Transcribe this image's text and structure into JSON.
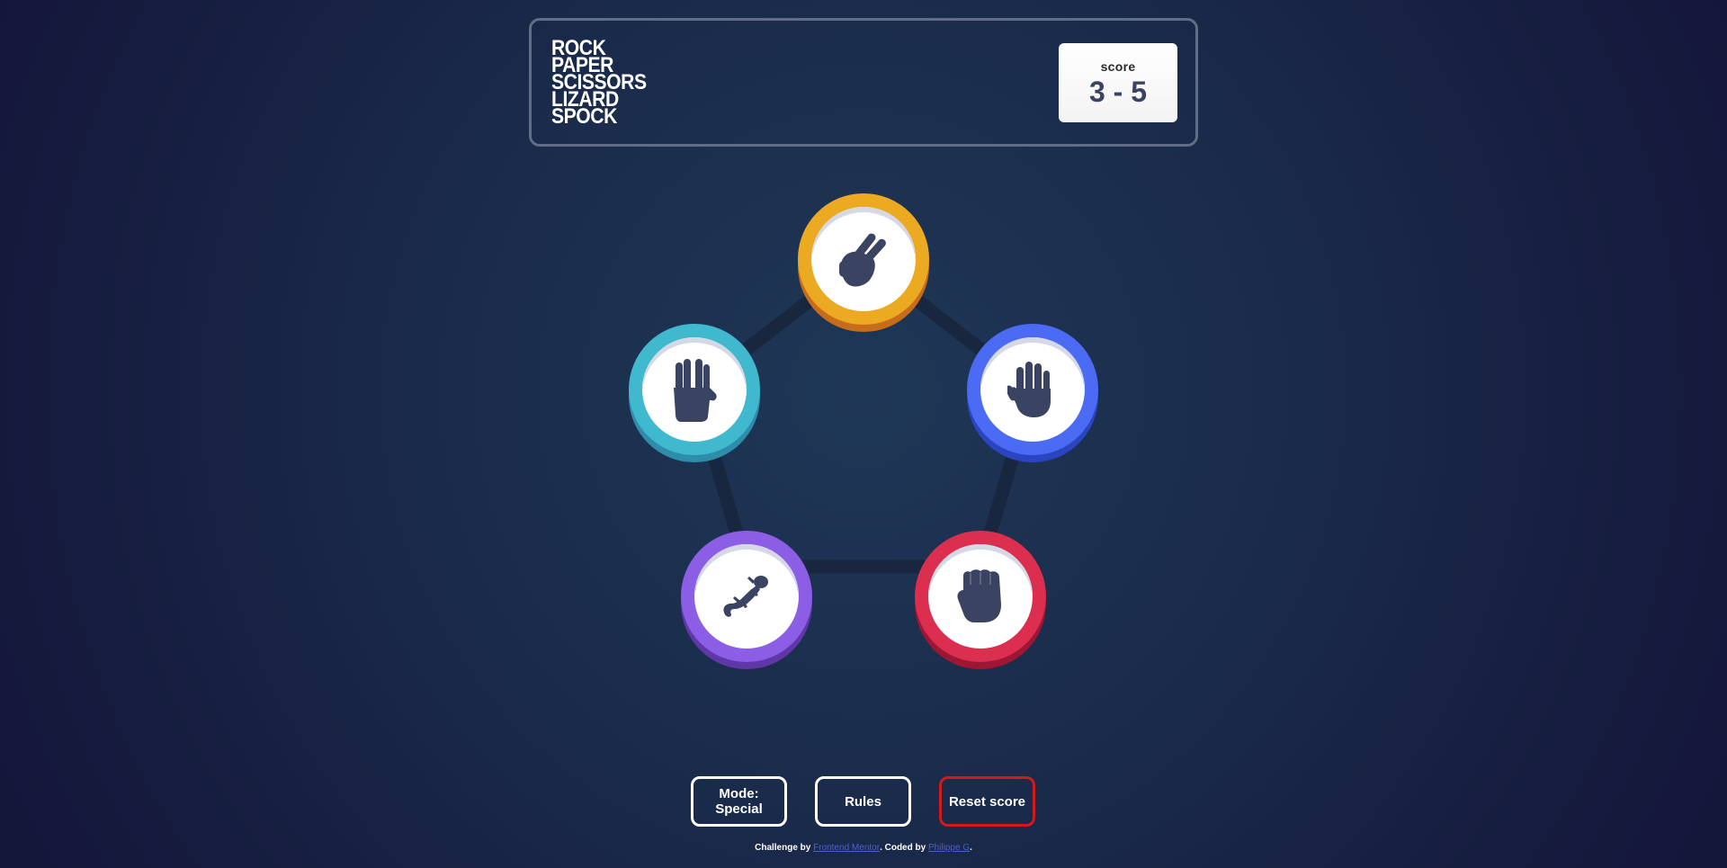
{
  "header": {
    "logo_lines": [
      "ROCK",
      "PAPER",
      "SCISSORS",
      "LIZARD",
      "SPOCK"
    ],
    "score_label": "score",
    "score_value": "3 - 5"
  },
  "board": {
    "tokens": [
      {
        "name": "scissors",
        "icon": "scissors-hand-icon",
        "ring_color": "#eca922"
      },
      {
        "name": "paper",
        "icon": "paper-hand-icon",
        "ring_color": "#4c6bf5"
      },
      {
        "name": "rock",
        "icon": "rock-fist-icon",
        "ring_color": "#dc2e4e"
      },
      {
        "name": "lizard",
        "icon": "lizard-icon",
        "ring_color": "#8c5de5"
      },
      {
        "name": "spock",
        "icon": "spock-hand-icon",
        "ring_color": "#40b9ce"
      }
    ],
    "pentagon_color": "#182640"
  },
  "controls": {
    "mode_label": "Mode: Special",
    "rules_label": "Rules",
    "reset_label": "Reset score"
  },
  "footer": {
    "prefix": "Challenge by ",
    "mentor_link": "Frontend Mentor",
    "middle": ". Coded by ",
    "author_link": "Philippe G",
    "suffix": "."
  },
  "colors": {
    "icon_fill": "#3b4363",
    "reset_border": "#d11a1a",
    "link": "#4a5fd6"
  }
}
